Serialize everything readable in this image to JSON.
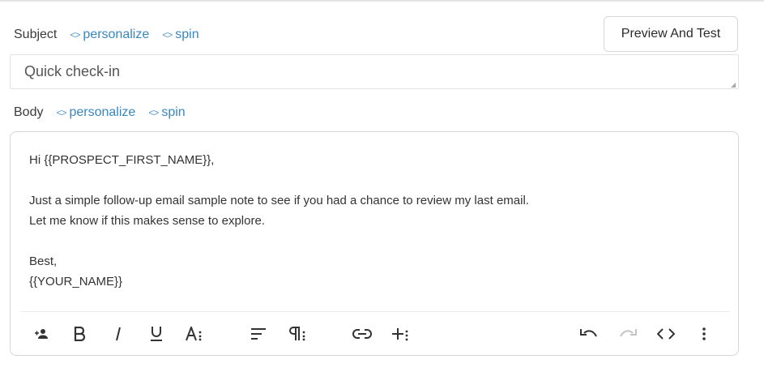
{
  "subject": {
    "label": "Subject",
    "personalize_label": "personalize",
    "spin_label": "spin",
    "value": "Quick check-in"
  },
  "preview_button": {
    "label": "Preview And Test"
  },
  "body": {
    "label": "Body",
    "personalize_label": "personalize",
    "spin_label": "spin",
    "lines": [
      "Hi {{PROSPECT_FIRST_NAME}},",
      "",
      "Just a simple follow-up email sample note to see if you had a chance to review my last email.",
      "Let me know if this makes sense to explore.",
      "",
      "Best,",
      "{{YOUR_NAME}}"
    ]
  },
  "toolbar": {
    "icons": [
      "add-person-icon",
      "bold-icon",
      "italic-icon",
      "underline-icon",
      "font-size-icon",
      "align-icon",
      "paragraph-icon",
      "link-icon",
      "insert-more-icon",
      "undo-icon",
      "redo-icon",
      "code-view-icon",
      "more-vert-icon"
    ],
    "redo_enabled": false
  },
  "colors": {
    "link": "#3a86c0",
    "text": "#2b2b2b",
    "border": "#d6d6d6",
    "icon_disabled": "#c4c4c4"
  }
}
